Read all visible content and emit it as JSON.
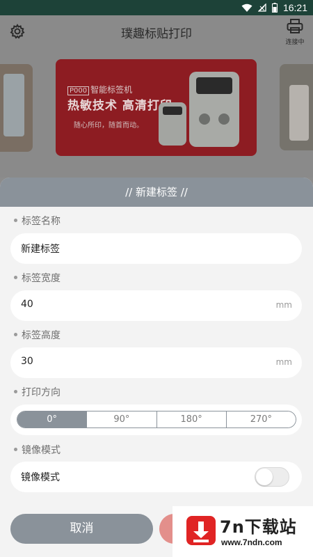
{
  "status_bar": {
    "time": "16:21"
  },
  "header": {
    "title": "璞趣标贴打印",
    "connect_label": "连接中"
  },
  "banner": {
    "model": "P000",
    "model_suffix": "智能标签机",
    "headline": "热敏技术 高清打印",
    "subline": "随心所印，随首而动。"
  },
  "sheet": {
    "title": "// 新建标签 //",
    "fields": {
      "name": {
        "label": "标签名称",
        "value": "新建标签"
      },
      "width": {
        "label": "标签宽度",
        "value": "40",
        "unit": "mm"
      },
      "height": {
        "label": "标签高度",
        "value": "30",
        "unit": "mm"
      }
    },
    "direction": {
      "label": "打印方向",
      "options": [
        "0°",
        "90°",
        "180°",
        "270°"
      ],
      "selected": "0°"
    },
    "mirror": {
      "label": "镜像模式",
      "row_label": "镜像模式",
      "enabled": false
    },
    "cancel_label": "取消"
  },
  "watermark": {
    "title": "7n下载站",
    "url": "www.7ndn.com"
  },
  "colors": {
    "status_bar": "#1d4238",
    "sheet_header": "#8a929a",
    "confirm": "#e38f8b",
    "watermark_red": "#e02424"
  }
}
